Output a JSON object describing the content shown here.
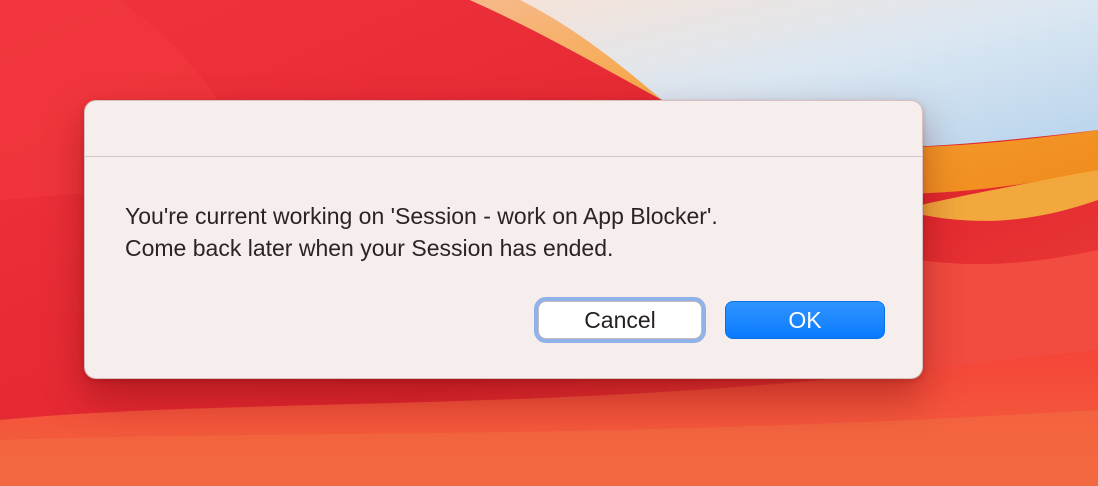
{
  "desktop": {
    "wallpaper": "red-orange-wave-wallpaper"
  },
  "dialog": {
    "title": "",
    "message_line1": "You're current working on 'Session - work on App Blocker'.",
    "message_line2": "Come back later when your Session has ended.",
    "cancel_label": "Cancel",
    "ok_label": "OK"
  },
  "colors": {
    "accent_blue": "#0a7aff",
    "focus_ring": "#6e9ee8",
    "dialog_bg": "#f6eded"
  }
}
